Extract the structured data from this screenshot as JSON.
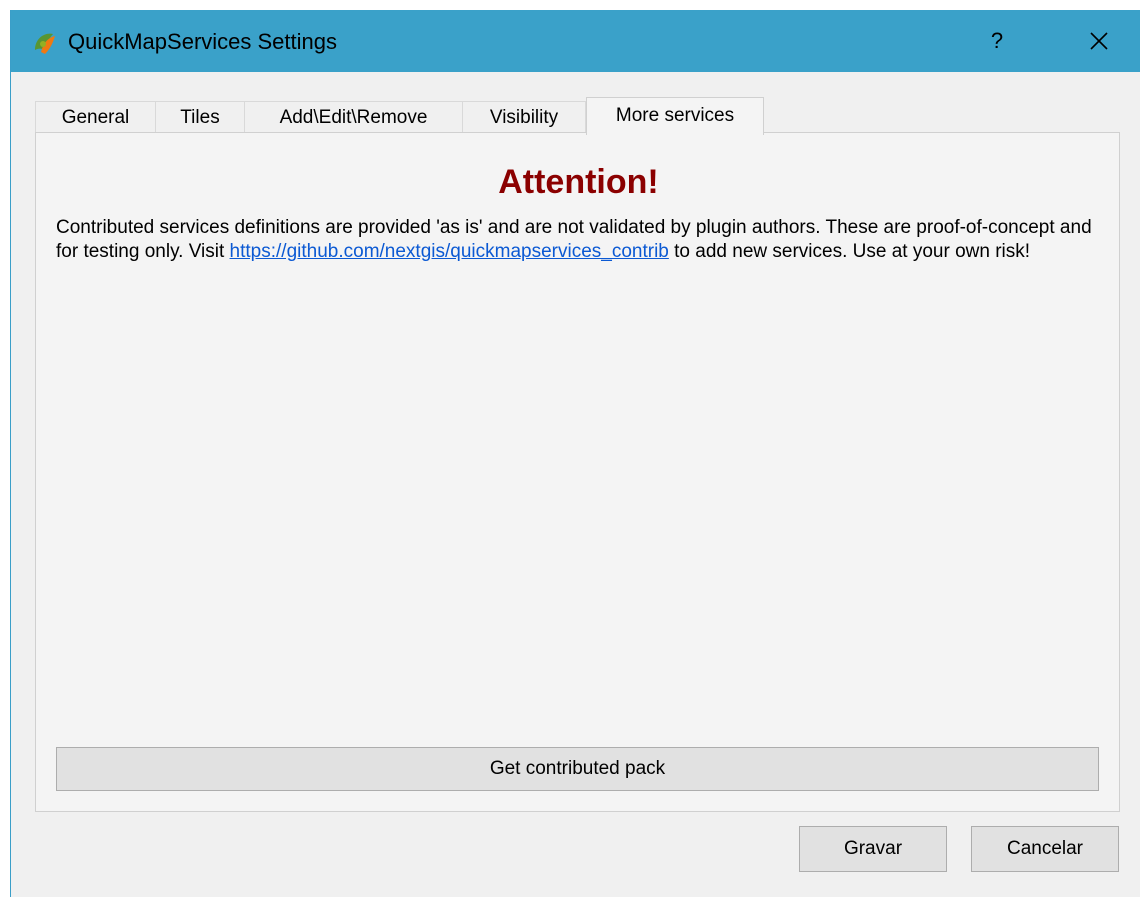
{
  "window": {
    "title": "QuickMapServices Settings",
    "help_label": "?",
    "app_icon": "qgis-logo-icon",
    "close_icon": "close-icon"
  },
  "tabs": [
    {
      "label": "General",
      "active": false
    },
    {
      "label": "Tiles",
      "active": false
    },
    {
      "label": "Add\\Edit\\Remove",
      "active": false
    },
    {
      "label": "Visibility",
      "active": false
    },
    {
      "label": "More services",
      "active": true
    }
  ],
  "more_services": {
    "heading": "Attention!",
    "text_before_link": "Contributed services definitions are provided 'as is' and are not validated by plugin authors. These are proof-of-concept and for testing only. Visit ",
    "link_text": "https://github.com/nextgis/quickmapservices_contrib",
    "text_after_link": " to add new services. Use at your own risk!",
    "pack_button_label": "Get contributed pack"
  },
  "footer": {
    "save_label": "Gravar",
    "cancel_label": "Cancelar"
  },
  "colors": {
    "titlebar": "#3aa1c9",
    "heading": "#8b0000",
    "link": "#0b59d3"
  }
}
